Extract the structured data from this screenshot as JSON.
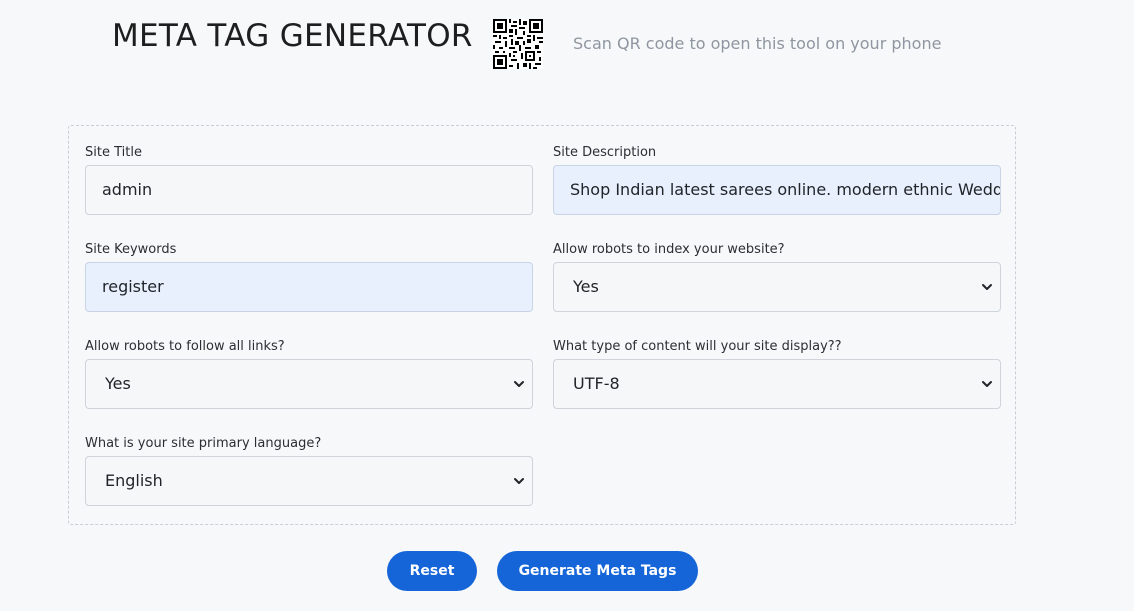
{
  "header": {
    "title": "META TAG GENERATOR",
    "qr_caption": "Scan QR code to open this tool on your phone",
    "qr_icon": "qr-code-icon"
  },
  "form": {
    "site_title": {
      "label": "Site Title",
      "value": "admin"
    },
    "site_description": {
      "label": "Site Description",
      "value": "Shop Indian latest sarees online. modern ethnic Wedding sarees"
    },
    "site_keywords": {
      "label": "Site Keywords",
      "value": "register"
    },
    "robots_index": {
      "label": "Allow robots to index your website?",
      "value": "Yes"
    },
    "robots_follow": {
      "label": "Allow robots to follow all links?",
      "value": "Yes"
    },
    "content_type": {
      "label": "What type of content will your site display??",
      "value": "UTF-8"
    },
    "language": {
      "label": "What is your site primary language?",
      "value": "English"
    }
  },
  "actions": {
    "reset_label": "Reset",
    "generate_label": "Generate Meta Tags"
  },
  "colors": {
    "accent": "#1565d8",
    "autofill_bg": "#e8f0fe",
    "page_bg": "#f6f8fa"
  }
}
